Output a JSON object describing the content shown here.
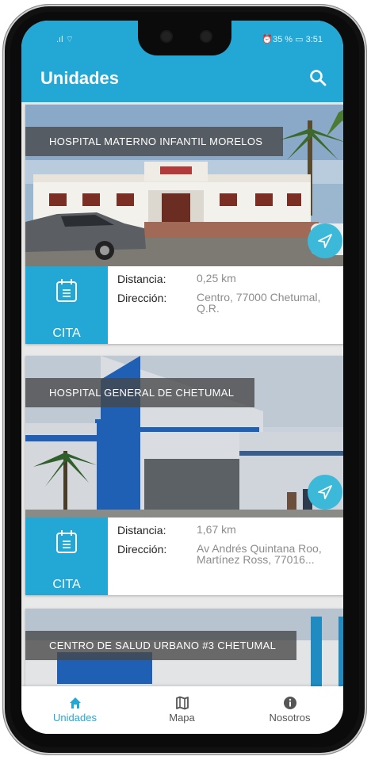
{
  "status_bar": {
    "signal_text": ".ıl ⌔",
    "right_text": "⏰35 % ▭ 3:51"
  },
  "app_bar": {
    "title": "Unidades",
    "search_icon": "search-icon"
  },
  "cards": [
    {
      "name": "HOSPITAL MATERNO INFANTIL MORELOS",
      "cita_label": "CITA",
      "distance_label": "Distancia:",
      "distance": "0,25 km",
      "address_label": "Dirección:",
      "address": "Centro, 77000 Chetumal, Q.R."
    },
    {
      "name": "HOSPITAL GENERAL DE CHETUMAL",
      "cita_label": "CITA",
      "distance_label": "Distancia:",
      "distance": "1,67 km",
      "address_label": "Dirección:",
      "address": "Av Andrés Quintana Roo, Martínez Ross, 77016..."
    },
    {
      "name": "CENTRO DE SALUD URBANO #3 CHETUMAL"
    }
  ],
  "bottom_nav": {
    "items": [
      {
        "label": "Unidades",
        "icon": "home-icon",
        "active": true
      },
      {
        "label": "Mapa",
        "icon": "map-icon",
        "active": false
      },
      {
        "label": "Nosotros",
        "icon": "info-icon",
        "active": false
      }
    ]
  },
  "colors": {
    "primary": "#23a8d6",
    "nav_button": "#3cb8d8",
    "banner": "#464646"
  }
}
